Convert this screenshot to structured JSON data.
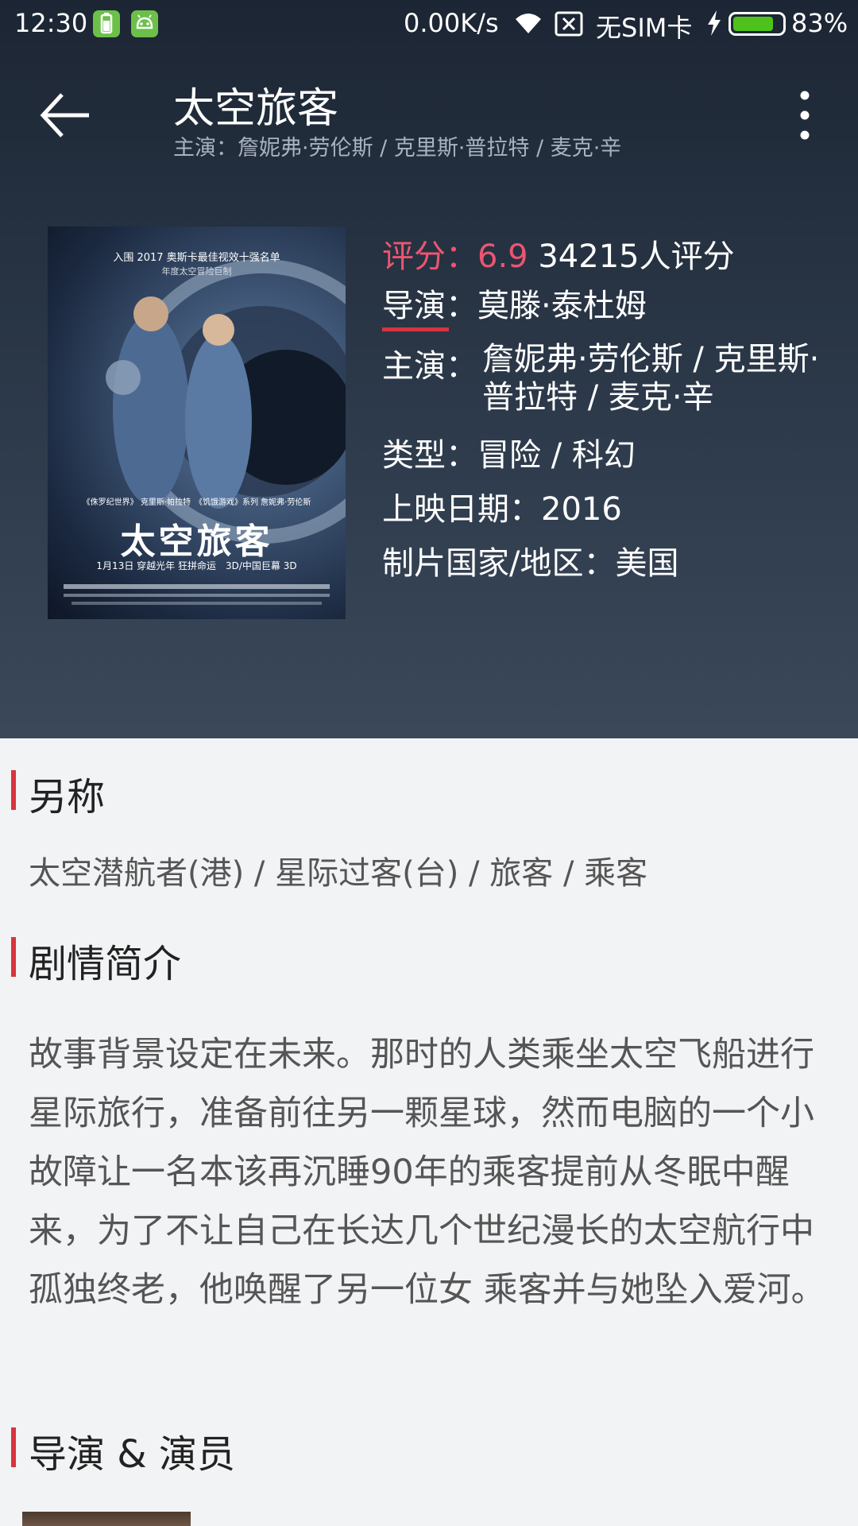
{
  "status_bar": {
    "time": "12:30",
    "network_speed": "0.00K/s",
    "carrier": "无SIM卡",
    "battery_percent": "83%",
    "battery_level": 0.83,
    "icons": [
      "battery-app-icon",
      "android-app-icon",
      "wifi-icon",
      "no-sim-icon",
      "charging-icon",
      "battery-icon"
    ]
  },
  "toolbar": {
    "title": "太空旅客",
    "subtitle": "主演：詹妮弗·劳伦斯 / 克里斯·普拉特 / 麦克·辛",
    "back_icon": "arrow-left-icon",
    "more_icon": "more-vertical-icon"
  },
  "poster": {
    "top_text": "入围 2017 奥斯卡最佳视效十强名单",
    "top_subtext": "年度太空冒险巨制",
    "cast_text": "《侏罗纪世界》 克里斯·帕拉特　《饥饿游戏》系列 詹妮弗·劳伦斯",
    "movie_name": "太空旅客",
    "date_text": "1月13日 穿越光年 狂拼命运　3D/中国巨幕 3D"
  },
  "info": {
    "rating_label": "评分：",
    "rating_value": "6.9",
    "rating_count": "34215人评分",
    "director_label": "导演：",
    "director_value": "莫滕·泰杜姆",
    "cast_label": "主演：",
    "cast_value": "詹妮弗·劳伦斯 / 克里斯·普拉特 / 麦克·辛",
    "genre_label": "类型：",
    "genre_value": "冒险 / 科幻",
    "release_label": "上映日期：",
    "release_value": "2016",
    "country_label": "制片国家/地区：",
    "country_value": "美国"
  },
  "sections": {
    "aka_title": "另称",
    "aka_text": "太空潜航者(港) / 星际过客(台) / 旅客 / 乘客",
    "synopsis_title": "剧情简介",
    "synopsis_text": "故事背景设定在未来。那时的人类乘坐太空飞船进行星际旅行，准备前往另一颗星球，然而电脑的一个小故障让一名本该再沉睡90年的乘客提前从冬眠中醒来，为了不让自己在长达几个世纪漫长的太空航行中孤独终老，他唤醒了另一位女 乘客并与她坠入爱河。",
    "cast_title": "导演 & 演员"
  },
  "colors": {
    "accent_red": "#d8343f",
    "rating_pink": "#ec5571",
    "header_bg": "#2e3b4c",
    "body_bg": "#f2f3f5"
  }
}
